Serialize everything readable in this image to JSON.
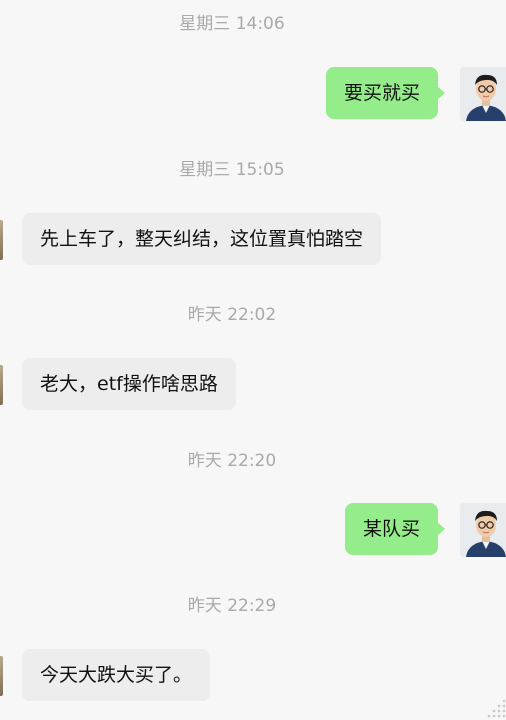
{
  "messages": [
    {
      "type": "timestamp",
      "text": "星期三 14:06"
    },
    {
      "type": "sent",
      "text": "要买就买",
      "avatar": "user-avatar"
    },
    {
      "type": "timestamp",
      "text": "星期三 15:05"
    },
    {
      "type": "received",
      "text": "先上车了，整天纠结，这位置真怕踏空"
    },
    {
      "type": "timestamp",
      "text": "昨天 22:02"
    },
    {
      "type": "received",
      "text": "老大，etf操作啥思路"
    },
    {
      "type": "timestamp",
      "text": "昨天 22:20"
    },
    {
      "type": "sent",
      "text": "某队买",
      "avatar": "user-avatar"
    },
    {
      "type": "timestamp",
      "text": "昨天 22:29"
    },
    {
      "type": "received",
      "text": "今天大跌大买了。"
    }
  ],
  "colors": {
    "background": "#f7f7f7",
    "sent_bubble": "#95ec8b",
    "received_bubble": "#ededed",
    "timestamp_text": "#a9a9a9"
  }
}
